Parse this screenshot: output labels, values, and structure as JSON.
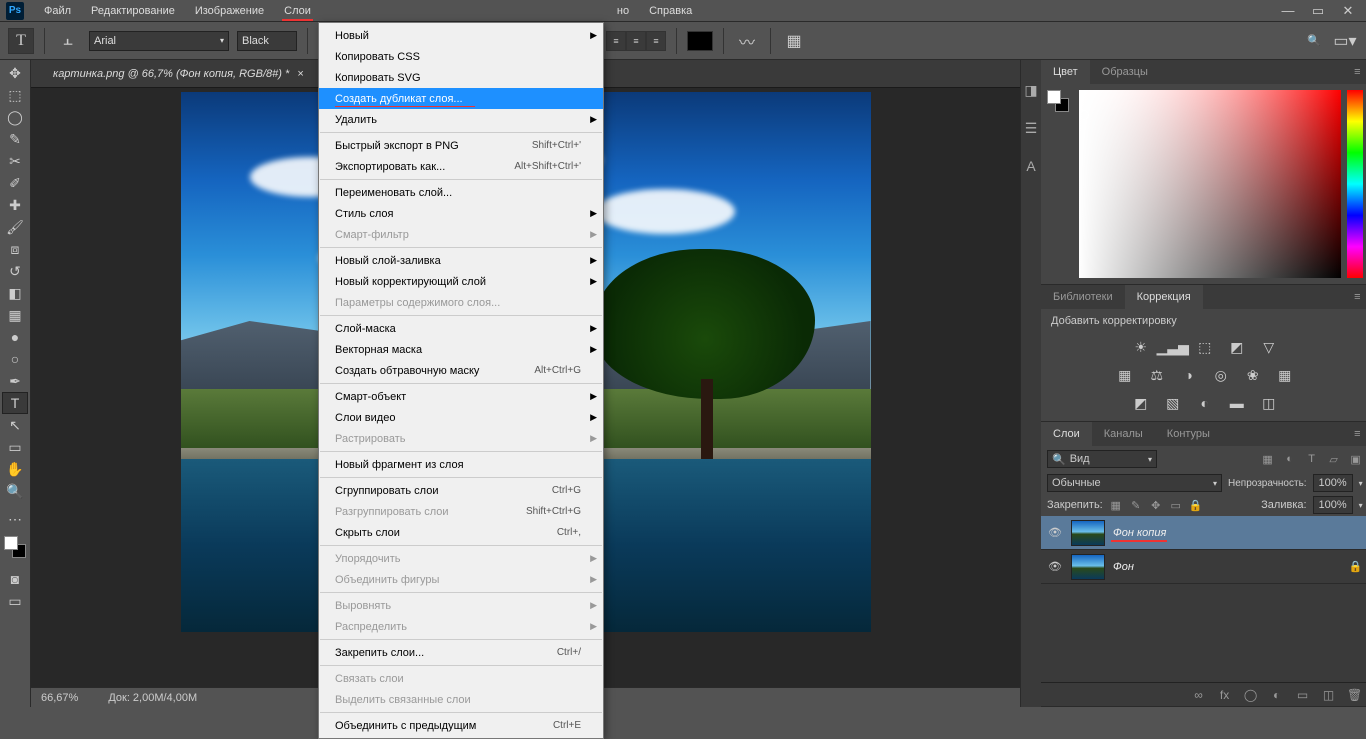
{
  "app": {
    "logo": "Ps"
  },
  "menubar": {
    "items": [
      "Файл",
      "Редактирование",
      "Изображение",
      "Слои",
      "",
      "",
      "",
      "",
      "но",
      "Справка"
    ],
    "underlined_index": 3
  },
  "options": {
    "font": "Arial",
    "color": "Black"
  },
  "doc_tab": {
    "title": "картинка.png @ 66,7% (Фон копия, RGB/8#) *",
    "close": "×"
  },
  "statusbar": {
    "zoom": "66,67%",
    "doc_size": "Док: 2,00M/4,00M"
  },
  "dropdown": [
    {
      "label": "Новый",
      "submenu": true
    },
    {
      "label": "Копировать CSS"
    },
    {
      "label": "Копировать SVG"
    },
    {
      "label": "Создать дубликат слоя...",
      "highlighted": true,
      "underlined": true
    },
    {
      "label": "Удалить",
      "submenu": true
    },
    {
      "sep": true
    },
    {
      "label": "Быстрый экспорт в PNG",
      "shortcut": "Shift+Ctrl+'"
    },
    {
      "label": "Экспортировать как...",
      "shortcut": "Alt+Shift+Ctrl+'"
    },
    {
      "sep": true
    },
    {
      "label": "Переименовать слой..."
    },
    {
      "label": "Стиль слоя",
      "submenu": true
    },
    {
      "label": "Смарт-фильтр",
      "submenu": true,
      "disabled": true
    },
    {
      "sep": true
    },
    {
      "label": "Новый слой-заливка",
      "submenu": true
    },
    {
      "label": "Новый корректирующий слой",
      "submenu": true
    },
    {
      "label": "Параметры содержимого слоя...",
      "disabled": true
    },
    {
      "sep": true
    },
    {
      "label": "Слой-маска",
      "submenu": true
    },
    {
      "label": "Векторная маска",
      "submenu": true
    },
    {
      "label": "Создать обтравочную маску",
      "shortcut": "Alt+Ctrl+G"
    },
    {
      "sep": true
    },
    {
      "label": "Смарт-объект",
      "submenu": true
    },
    {
      "label": "Слои видео",
      "submenu": true
    },
    {
      "label": "Растрировать",
      "submenu": true,
      "disabled": true
    },
    {
      "sep": true
    },
    {
      "label": "Новый фрагмент из слоя"
    },
    {
      "sep": true
    },
    {
      "label": "Сгруппировать слои",
      "shortcut": "Ctrl+G"
    },
    {
      "label": "Разгруппировать слои",
      "shortcut": "Shift+Ctrl+G",
      "disabled": true
    },
    {
      "label": "Скрыть слои",
      "shortcut": "Ctrl+,"
    },
    {
      "sep": true
    },
    {
      "label": "Упорядочить",
      "submenu": true,
      "disabled": true
    },
    {
      "label": "Объединить фигуры",
      "submenu": true,
      "disabled": true
    },
    {
      "sep": true
    },
    {
      "label": "Выровнять",
      "submenu": true,
      "disabled": true
    },
    {
      "label": "Распределить",
      "submenu": true,
      "disabled": true
    },
    {
      "sep": true
    },
    {
      "label": "Закрепить слои...",
      "shortcut": "Ctrl+/"
    },
    {
      "sep": true
    },
    {
      "label": "Связать слои",
      "disabled": true
    },
    {
      "label": "Выделить связанные слои",
      "disabled": true
    },
    {
      "sep": true
    },
    {
      "label": "Объединить с предыдущим",
      "shortcut": "Ctrl+E"
    }
  ],
  "panels": {
    "color_tab": "Цвет",
    "swatches_tab": "Образцы",
    "libraries_tab": "Библиотеки",
    "adjustments_tab": "Коррекция",
    "adjustments_label": "Добавить корректировку",
    "layers_tab": "Слои",
    "channels_tab": "Каналы",
    "paths_tab": "Контуры",
    "filter_kind": "Вид",
    "blend_mode": "Обычные",
    "opacity_label": "Непрозрачность:",
    "opacity_value": "100%",
    "lock_label": "Закрепить:",
    "fill_label": "Заливка:",
    "fill_value": "100%"
  },
  "layers": [
    {
      "name": "Фон копия",
      "selected": true,
      "underlined": true,
      "locked": false
    },
    {
      "name": "Фон",
      "selected": false,
      "underlined": false,
      "locked": true
    }
  ]
}
